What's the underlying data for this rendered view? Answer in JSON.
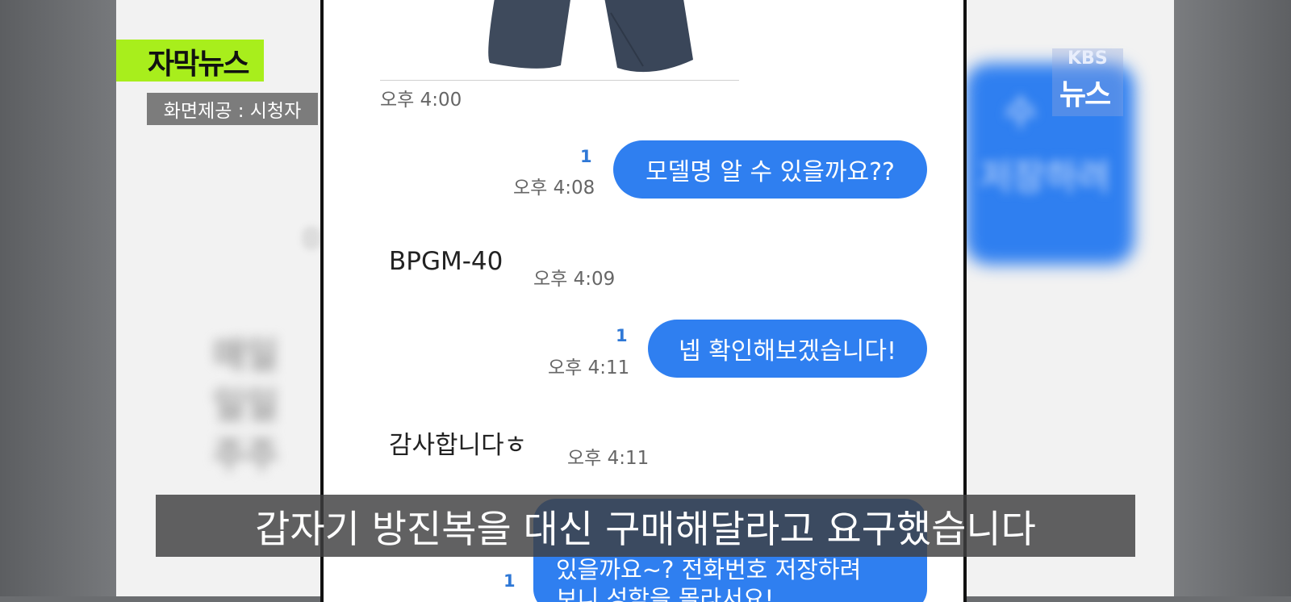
{
  "overlay": {
    "program_badge": "자막뉴스",
    "credit": "화면제공 : 시청자",
    "broadcaster_top": "KBS",
    "broadcaster_bottom": "뉴스",
    "subtitle": "갑자기 방진복을 대신 구매해달라고 요구했습니다"
  },
  "chat": {
    "image_time": "오후 4:00",
    "messages": [
      {
        "direction": "sent",
        "text": "모델명 알 수 있을까요??",
        "time": "오후 4:08",
        "unread": "1"
      },
      {
        "direction": "received",
        "text": "BPGM-40",
        "time": "오후 4:09"
      },
      {
        "direction": "sent",
        "text": "넵 확인해보겠습니다!",
        "time": "오후 4:11",
        "unread": "1"
      },
      {
        "direction": "received",
        "text": "감사합니다ㅎ",
        "time": "오후 4:11"
      },
      {
        "direction": "sent",
        "text": "혹시 ... 있을까요~? 전화번호 저장하려 보니 성함을 몰라서요!",
        "unread": "1"
      }
    ],
    "partial_lines": [
      "있을까요~? 전화번호 저장하려",
      "보니 성함을 몰라서요!"
    ]
  },
  "colors": {
    "sent_bubble": "#2f7ff0",
    "badge_green": "#a8ee1c"
  }
}
